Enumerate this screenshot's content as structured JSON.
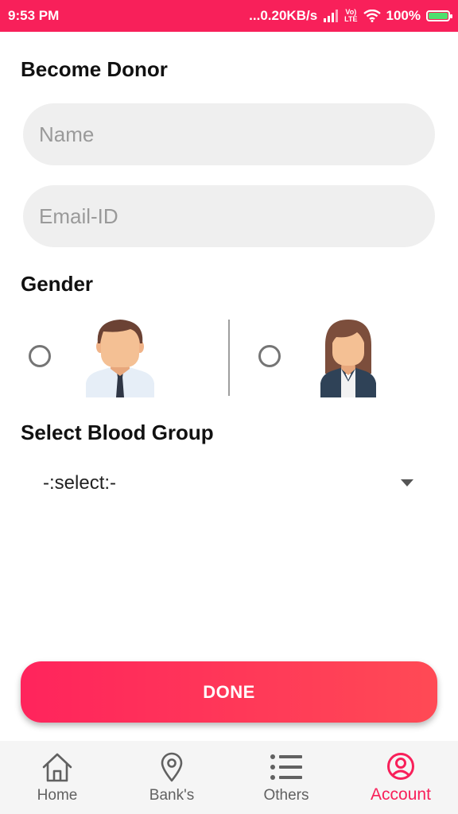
{
  "status_bar": {
    "time": "9:53 PM",
    "network_speed": "...0.20KB/s",
    "volte_top": "Vo)",
    "volte_bottom": "LTE",
    "battery": "100%"
  },
  "form": {
    "title": "Become Donor",
    "name_placeholder": "Name",
    "email_placeholder": "Email-ID",
    "gender_label": "Gender",
    "gender_options": [
      "male",
      "female"
    ],
    "blood_group_label": "Select Blood Group",
    "blood_group_selected": "-:select:-",
    "done_label": "DONE"
  },
  "bottom_nav": {
    "items": [
      {
        "label": "Home",
        "icon": "home-icon"
      },
      {
        "label": "Bank's",
        "icon": "location-pin-icon"
      },
      {
        "label": "Others",
        "icon": "list-icon"
      },
      {
        "label": "Account",
        "icon": "account-circle-icon",
        "active": true
      }
    ]
  },
  "colors": {
    "accent": "#f8205a",
    "field_bg": "#efefef"
  }
}
